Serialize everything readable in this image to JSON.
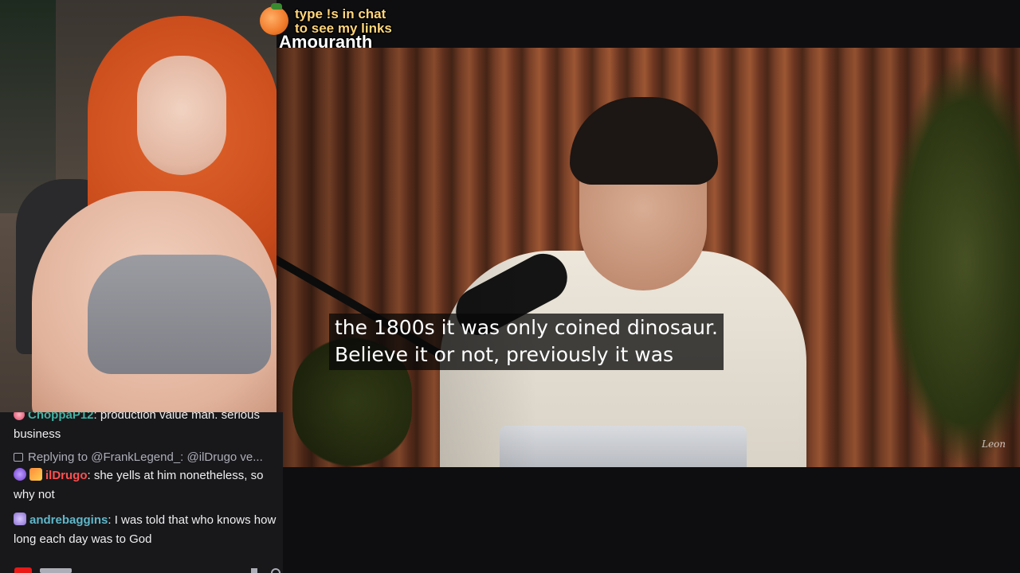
{
  "overlay": {
    "promo_line1": "type !s in chat",
    "promo_line2": "to see my links",
    "channel_name": "Amouranth",
    "promo_color": "#ffd57a"
  },
  "video": {
    "caption_line1": "the 1800s it was only coined dinosaur.",
    "caption_line2": "Believe it or not, previously it was",
    "watermark": "Leon"
  },
  "chat": {
    "messages": [
      {
        "username": "ChoppaP12",
        "username_color": "#41b3a3",
        "text": ": production value man. serious business",
        "badges": [
          "avatar-icon"
        ]
      },
      {
        "reply_prefix": "Replying to @FrankLegend_: @ilDrugo ve...",
        "username": "ilDrugo",
        "username_color": "#ff4f4f",
        "text": ": she yells at him nonetheless, so why not",
        "badges": [
          "avatar-icon",
          "sub-badge-icon"
        ]
      },
      {
        "username": "andrebaggins",
        "username_color": "#5fb7c9",
        "text": ": I was told that who knows how long each day was to God",
        "badges": [
          "robot-avatar-icon"
        ]
      }
    ]
  }
}
